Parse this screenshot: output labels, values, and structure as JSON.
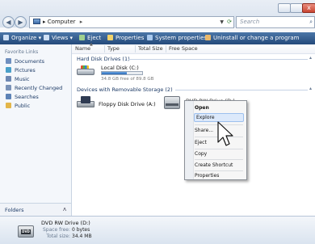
{
  "window": {
    "address": {
      "location": "Computer",
      "arrow": "▸"
    },
    "search": {
      "placeholder": "Search"
    },
    "close_glyph": "x"
  },
  "toolbar": {
    "items": [
      "Organize",
      "Views",
      "Eject",
      "Properties",
      "System properties",
      "Uninstall or change a program"
    ]
  },
  "nav": {
    "title": "Favorite Links",
    "items": [
      "Documents",
      "Pictures",
      "Music",
      "Recently Changed",
      "Searches",
      "Public"
    ],
    "folders_label": "Folders"
  },
  "columns": [
    "Name",
    "Type",
    "Total Size",
    "Free Space"
  ],
  "groups": {
    "hdd": "Hard Disk Drives (1)",
    "removable": "Devices with Removable Storage (2)"
  },
  "drives": {
    "local": {
      "name": "Local Disk (C:)",
      "free": "34.8 GB free of 89.8 GB",
      "used_fraction": 0.61
    },
    "floppy": {
      "name": "Floppy Disk Drive (A:)"
    },
    "dvd": {
      "name": "DVD RW Drive (D:)"
    }
  },
  "context_menu": {
    "items": [
      "Open",
      "Explore",
      "Share...",
      "Eject",
      "Copy",
      "Create Shortcut",
      "Properties"
    ]
  },
  "details": {
    "name": "DVD RW Drive (D:)",
    "space_free_label": "Space free:",
    "space_free": "0 bytes",
    "total_size_label": "Total size:",
    "total_size": "34.4 MB",
    "badge": "DVD"
  },
  "colors": {
    "accent": "#24497a",
    "highlight": "#dce9fb"
  }
}
